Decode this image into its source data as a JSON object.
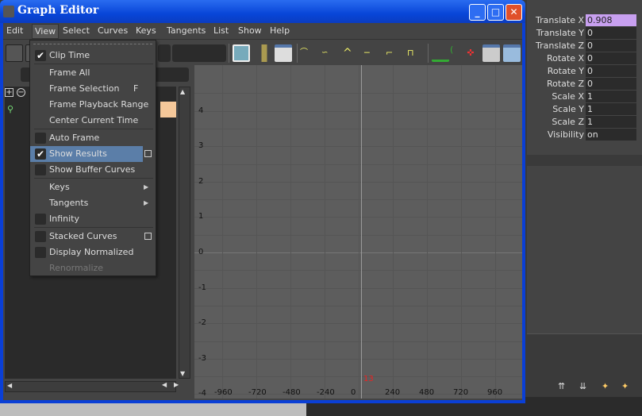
{
  "window": {
    "title": "Graph Editor",
    "minimize": "_",
    "maximize": "□",
    "close": "✕"
  },
  "menubar": [
    "Edit",
    "View",
    "Select",
    "Curves",
    "Keys",
    "Tangents",
    "List",
    "Show",
    "Help"
  ],
  "view_menu": [
    {
      "label": "Clip Time",
      "check": true,
      "checked": true
    },
    {
      "label": "Frame All"
    },
    {
      "label": "Frame Selection",
      "shortcut": "F"
    },
    {
      "label": "Frame Playback Range"
    },
    {
      "label": "Center Current Time"
    },
    {
      "label": "Auto Frame",
      "check": true,
      "checked": false
    },
    {
      "label": "Show Results",
      "check": true,
      "checked": true,
      "highlighted": true,
      "option_box": true
    },
    {
      "label": "Show Buffer Curves",
      "check": true,
      "checked": false
    },
    {
      "label": "Keys",
      "submenu": true
    },
    {
      "label": "Tangents",
      "submenu": true
    },
    {
      "label": "Infinity",
      "check": true,
      "checked": false
    },
    {
      "label": "Stacked Curves",
      "check": true,
      "checked": false,
      "option_box": true
    },
    {
      "label": "Display Normalized",
      "check": true,
      "checked": false
    },
    {
      "label": "Renormalize",
      "disabled": true
    }
  ],
  "graph": {
    "y_ticks": [
      "4",
      "3",
      "2",
      "1",
      "0",
      "-1",
      "-2",
      "-3",
      "-4"
    ],
    "x_ticks": [
      "-960",
      "-720",
      "-480",
      "-240",
      "0",
      "240",
      "480",
      "720",
      "960"
    ],
    "current_time": "13"
  },
  "channel_box": [
    {
      "name": "Translate X",
      "value": "0.908",
      "highlighted": true
    },
    {
      "name": "Translate Y",
      "value": "0"
    },
    {
      "name": "Translate Z",
      "value": "0"
    },
    {
      "name": "Rotate X",
      "value": "0"
    },
    {
      "name": "Rotate Y",
      "value": "0"
    },
    {
      "name": "Rotate Z",
      "value": "0"
    },
    {
      "name": "Scale X",
      "value": "1"
    },
    {
      "name": "Scale Y",
      "value": "1"
    },
    {
      "name": "Scale Z",
      "value": "1"
    },
    {
      "name": "Visibility",
      "value": "on"
    }
  ],
  "colors": {
    "accent": "#5b7ea8",
    "highlight_field": "#c8a0f0",
    "title_blue": "#0846d8"
  }
}
